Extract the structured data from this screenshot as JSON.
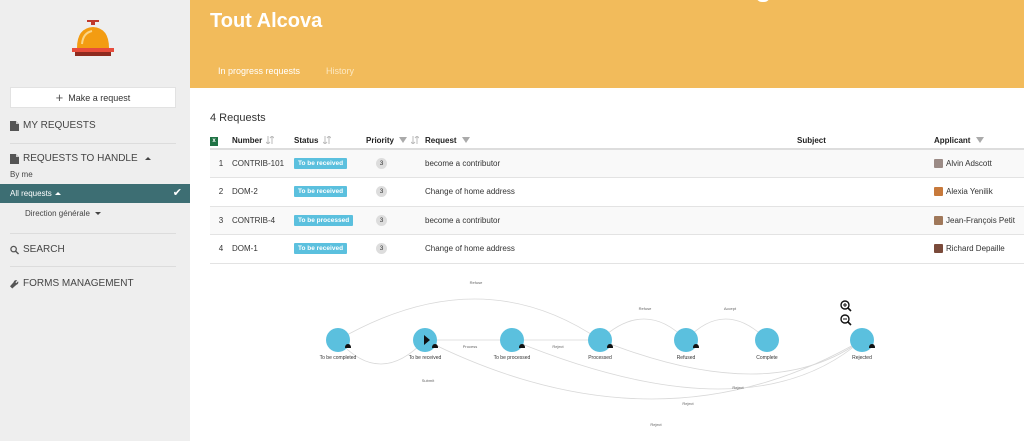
{
  "sidebar": {
    "logo_icon": "service-bell-icon",
    "make_request": "Make a request",
    "my_requests": "MY REQUESTS",
    "requests_to_handle": "REQUESTS TO HANDLE",
    "by_me": "By me",
    "all_requests": "All requests",
    "direction": "Direction générale",
    "search": "SEARCH",
    "forms_management": "FORMS MANAGEMENT"
  },
  "header": {
    "title": "Tout Alcova",
    "tabs": [
      {
        "label": "In progress requests",
        "active": true
      },
      {
        "label": "History",
        "active": false
      }
    ],
    "color": "#f2bb5b"
  },
  "main": {
    "count": "4 Requests",
    "columns": {
      "number": "Number",
      "status": "Status",
      "priority": "Priority",
      "request": "Request",
      "subject": "Subject",
      "applicant": "Applicant"
    },
    "rows": [
      {
        "idx": "1",
        "number": "CONTRIB-101",
        "status": "To be received",
        "priority": "3",
        "request": "become a contributor",
        "subject": "",
        "applicant": "Alvin Adscott"
      },
      {
        "idx": "2",
        "number": "DOM-2",
        "status": "To be received",
        "priority": "3",
        "request": "Change of home address",
        "subject": "",
        "applicant": "Alexia Yenilik"
      },
      {
        "idx": "3",
        "number": "CONTRIB-4",
        "status": "To be processed",
        "priority": "3",
        "request": "become a contributor",
        "subject": "",
        "applicant": "Jean-François Petit"
      },
      {
        "idx": "4",
        "number": "DOM-1",
        "status": "To be received",
        "priority": "3",
        "request": "Change of home address",
        "subject": "",
        "applicant": "Richard Depaille"
      }
    ]
  },
  "workflow": {
    "nodes": [
      "To be completed",
      "To be received",
      "To be processed",
      "Processed",
      "Refused",
      "Complete",
      "Rejected"
    ],
    "edges": [
      "Refuse",
      "Submit",
      "Process",
      "Reject",
      "Refuse",
      "Accept",
      "Reject",
      "Reject",
      "Reject"
    ]
  },
  "colors": {
    "accent": "#f2bb5b",
    "sidebar_active": "#3d6e73",
    "status_badge": "#5bc0de",
    "node": "#5bc0de"
  }
}
